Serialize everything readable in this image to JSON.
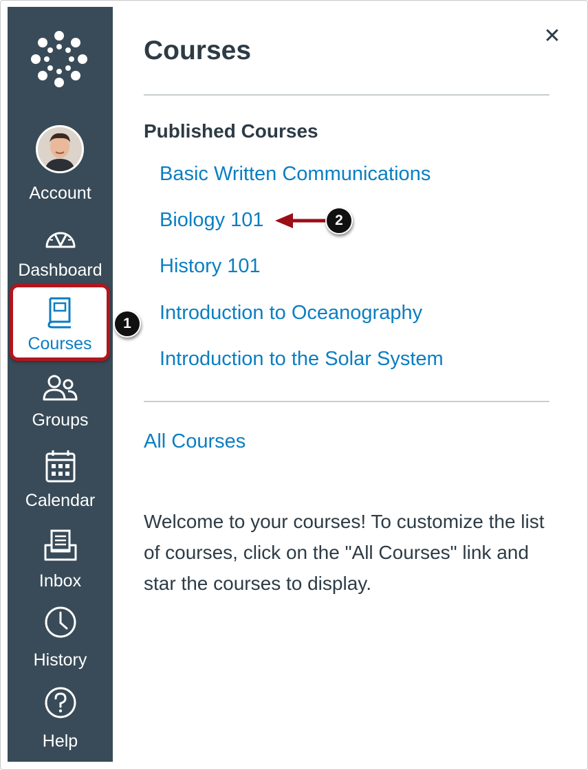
{
  "sidebar": {
    "logo_icon": "canvas-logo-icon",
    "items": [
      {
        "label": "Account",
        "icon": "avatar"
      },
      {
        "label": "Dashboard",
        "icon": "dashboard-icon"
      },
      {
        "label": "Courses",
        "icon": "courses-icon",
        "active": true
      },
      {
        "label": "Groups",
        "icon": "groups-icon"
      },
      {
        "label": "Calendar",
        "icon": "calendar-icon"
      },
      {
        "label": "Inbox",
        "icon": "inbox-icon"
      },
      {
        "label": "History",
        "icon": "history-icon"
      },
      {
        "label": "Help",
        "icon": "help-icon"
      }
    ]
  },
  "tray": {
    "title": "Courses",
    "close_icon": "close-icon",
    "close_glyph": "✕",
    "section_heading": "Published Courses",
    "courses": [
      "Basic Written Communications",
      "Biology 101",
      "History 101",
      "Introduction to Oceanography",
      "Introduction to the Solar System"
    ],
    "all_courses_label": "All Courses",
    "welcome_text": "Welcome to your courses! To customize the list of courses, click on the \"All Courses\" link and star the courses to display."
  },
  "callouts": {
    "first": "1",
    "second": "2"
  },
  "colors": {
    "sidebar_bg": "#394b58",
    "link": "#0a7ec2",
    "text": "#2d3b45",
    "highlight": "#b0161e"
  }
}
